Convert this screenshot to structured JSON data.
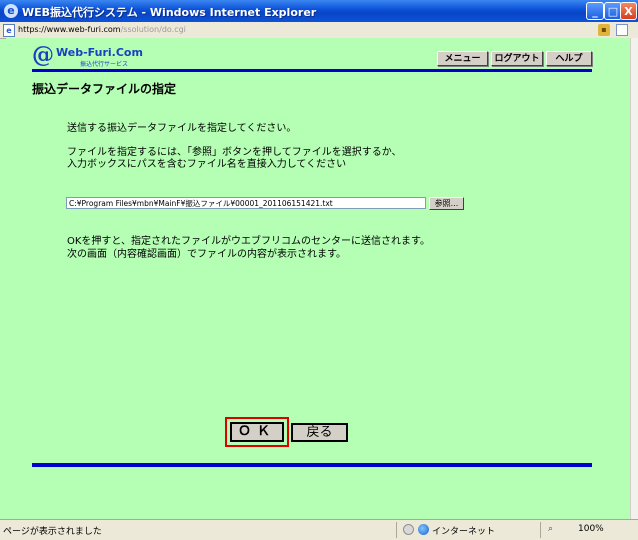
{
  "window": {
    "title": "WEB振込代行システム - Windows Internet Explorer",
    "minimize": "_",
    "maximize": "□",
    "close": "X"
  },
  "address": {
    "url_main": "https://www.web-furi.com",
    "url_path": "/ssolution/do.cgi"
  },
  "logo": {
    "mark": "@",
    "name": "Web-Furi.Com",
    "tagline": "振込代行サービス"
  },
  "nav": {
    "menu": "メニュー",
    "logout": "ログアウト",
    "help": "ヘルプ"
  },
  "page": {
    "heading": "振込データファイルの指定",
    "intro": "送信する振込データファイルを指定してください。",
    "instructions_line1": "ファイルを指定するには、「参照」ボタンを押してファイルを選択するか、",
    "instructions_line2": "入力ボックスにパスを含むファイル名を直接入力してください",
    "file_path": "C:¥Program Files¥mbn¥MainF¥振込ファイル¥00001_201106151421.txt",
    "browse_label": "参照...",
    "note_line1": "OKを押すと、指定されたファイルがウエブフリコムのセンターに送信されます。",
    "note_line2": "次の画面（内容確認画面）でファイルの内容が表示されます。",
    "ok_label": "ＯＫ",
    "back_label": "戻る"
  },
  "status": {
    "text": "ページが表示されました",
    "zone": "インターネット",
    "zoom": "100%"
  },
  "colors": {
    "page_bg": "#b4ffb4",
    "rule": "#0000d0",
    "highlight": "#e00000"
  }
}
